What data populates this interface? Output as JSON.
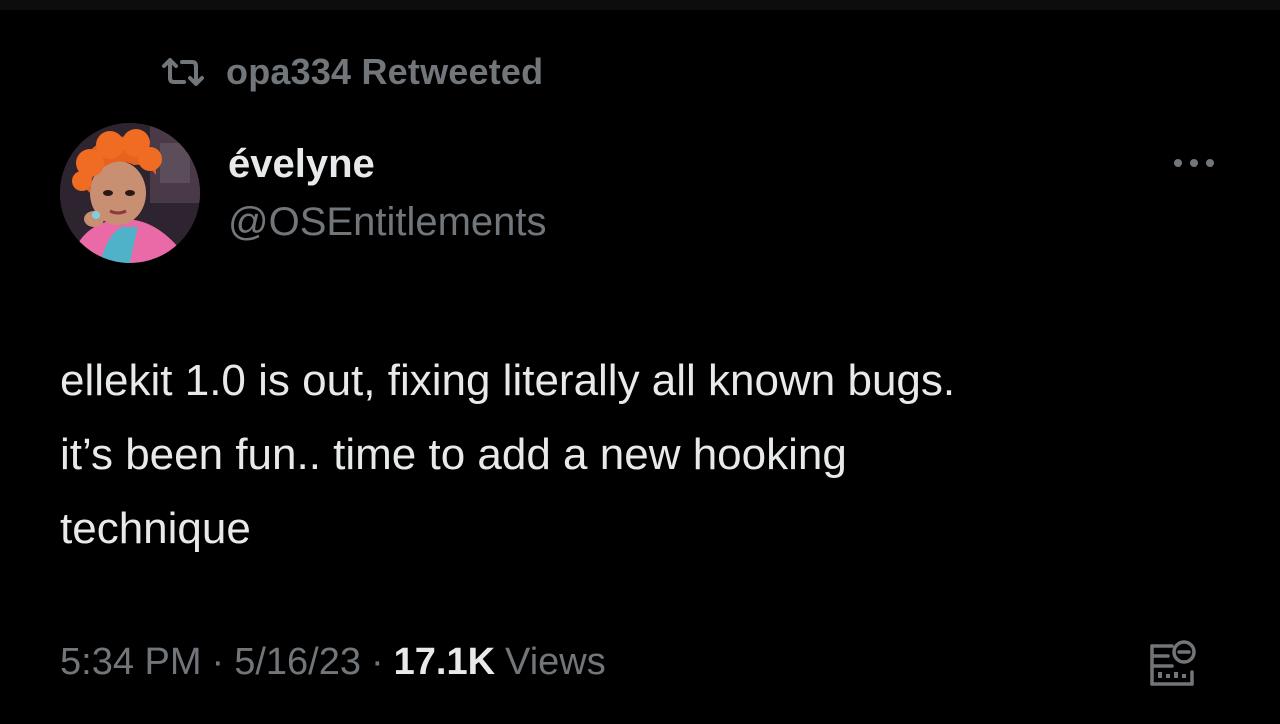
{
  "retweet": {
    "icon": "retweet-icon",
    "text": "opa334 Retweeted"
  },
  "author": {
    "display_name": "évelyne",
    "handle": "@OSEntitlements",
    "avatar_icon": "avatar"
  },
  "more_icon": "more-horizontal-icon",
  "tweet": {
    "lines": [
      "ellekit 1.0 is out, fixing literally all known bugs.",
      "it’s been fun.. time to add a new hooking",
      "technique"
    ]
  },
  "meta": {
    "time": "5:34 PM",
    "separator": "·",
    "date": "5/16/23",
    "views_count": "17.1K",
    "views_label": "Views"
  },
  "analytics_icon": "analytics-icon",
  "colors": {
    "background": "#000000",
    "primary_text": "#e7e9ea",
    "secondary_text": "#71767b"
  }
}
